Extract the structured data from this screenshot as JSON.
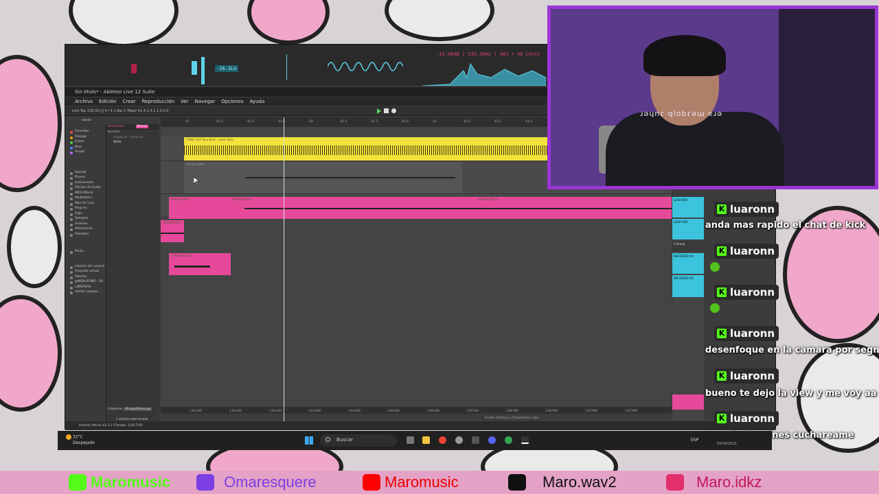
{
  "ableton": {
    "window_title": "Sin título* - Ableton Live 12 Suite",
    "menu": [
      "Archivo",
      "Edición",
      "Crear",
      "Reproducción",
      "Ver",
      "Navegar",
      "Opciones",
      "Ayuda"
    ],
    "meter_readout": "-26.3LU",
    "spectrum_readout": "-14.96dB | 539.36Hz | A#3 + 46 Cents",
    "control_bar": "Link  Tap  130.00  |||  4 / 4   1 Bar    C   Major        41.4.1     3.1.1.4.0.0",
    "browser": {
      "search": "wasan",
      "collections": [
        "Favoritos",
        "Orange",
        "Green",
        "Blue",
        "Purple"
      ],
      "categories": [
        "Sounds",
        "Drums",
        "Instruments",
        "Efectos de Audio",
        "MIDI Effects",
        "Modulators",
        "Max for Live",
        "Plug-ins",
        "Clips",
        "Samples",
        "Grooves",
        "Afinaciones",
        "Plantillas"
      ],
      "places": [
        "Packs",
        "Librería del usuario",
        "Proyecto actual",
        "Patches",
        "@MIDILATINO - 20",
        "LIBRERIAS",
        "Añadir carpeta..."
      ],
      "results_label": "Resultados",
      "clear_label": "Borrar",
      "name_header": "Nombre",
      "results": [
        "Grabacion - Lucho-bo...",
        "BRAN"
      ],
      "tags_label": "Etiquetas",
      "tag_value": "[Bridge]Morengo",
      "selection": "1 artículo seleccionado"
    },
    "ruler": [
      "41",
      "41.2",
      "41.3",
      "41.4",
      "42",
      "42.2",
      "42.3",
      "42.4",
      "43",
      "43.2",
      "43.3",
      "43.4"
    ],
    "time_ruler": [
      "1:02:000",
      "1:03:000",
      "1:03:000",
      "1:03:000",
      "1:04:000",
      "1:04:000",
      "1:05:000",
      "1:05:500",
      "1:06:000",
      "1:06:000",
      "1:07:000",
      "1:07:000"
    ],
    "clips": {
      "beat": "(FREE) Zell Type Beat - calvin klein",
      "rec1": "GRABACION 8",
      "rec2": "GRABACION 8",
      "rec3": "GRABACION 8",
      "rec4": "GRABACION 8",
      "rec5": "GRABACION 8",
      "rec6": "GRABACION 21"
    },
    "drop_message": "Suelte Archivos y Dispositivos aquí",
    "mixer": [
      "LEAD VOX",
      "LEAD VOX",
      "A Group",
      "REFUERZO VO",
      "REFUERZO VO"
    ],
    "status": "Insertar Marca 41.3.1 (Tiempo: 1:02:710)",
    "colors": {
      "beat_clip": "#f2e33b",
      "vocal_clip": "#e6499a",
      "mixer": "#3cc4de"
    }
  },
  "webcam_text": "ɹǝɥnɾ qlobɾǝɯ ɐɹǝ",
  "chat": [
    {
      "user": "luaronn",
      "message": "anda mas rapido el chat de kick"
    },
    {
      "user": "luaronn",
      "message": "",
      "emote": "emote-icon"
    },
    {
      "user": "luaronn",
      "message": "",
      "emote": "emote-icon"
    },
    {
      "user": "luaronn",
      "message": "desenfoque en la camara por segno"
    },
    {
      "user": "luaronn",
      "message": "bueno te dejo la view y me voy aa m"
    },
    {
      "user": "luaronn",
      "message": "cuando termines cuchareame"
    }
  ],
  "taskbar": {
    "temp": "32°C",
    "weather": "Despejado",
    "search": "Buscar",
    "lang": "ESP",
    "date": "09/09/2025"
  },
  "socials": [
    {
      "icon": "kick-icon",
      "label": "Maromusic",
      "color": "#53fc18"
    },
    {
      "icon": "twitch-icon",
      "label": "Omaresquere",
      "color": "#7b3fe4"
    },
    {
      "icon": "youtube-icon",
      "label": "Maromusic",
      "color": "#ff0000"
    },
    {
      "icon": "tiktok-icon",
      "label": "Maro.wav2",
      "color": "#111111"
    },
    {
      "icon": "instagram-icon",
      "label": "Maro.idkz",
      "color": "#e1306c"
    }
  ]
}
